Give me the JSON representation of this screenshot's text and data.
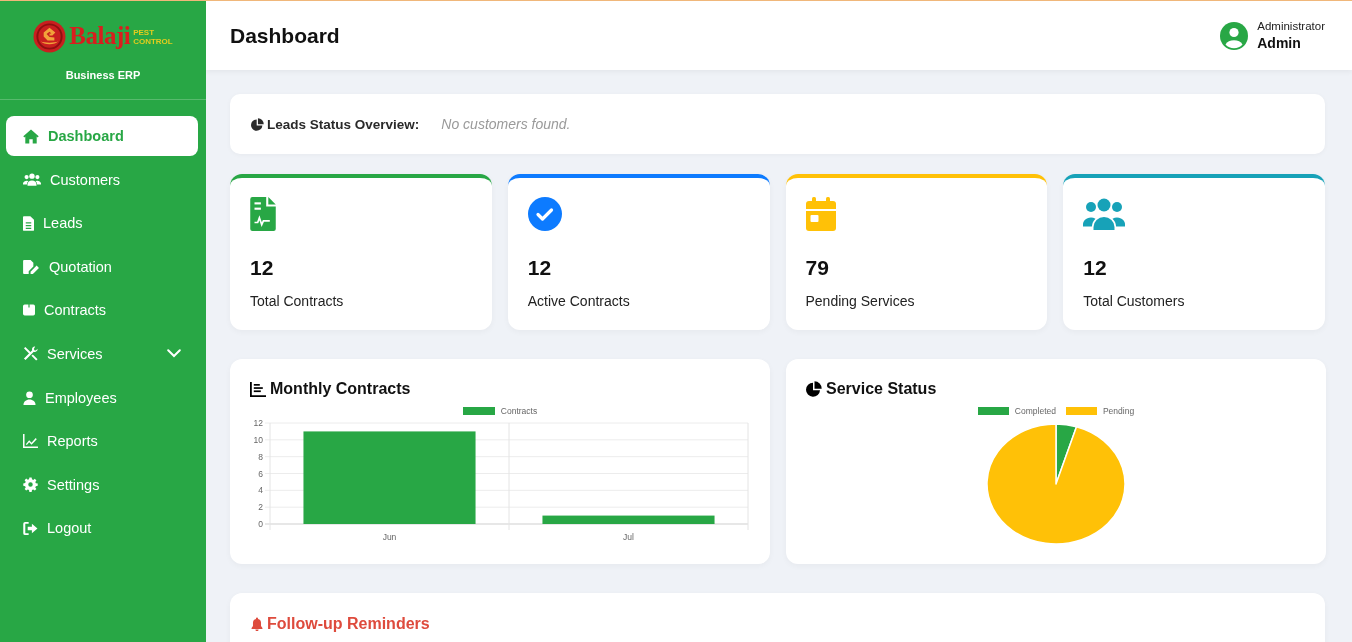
{
  "sidebar": {
    "logo": {
      "name": "Balaji",
      "tagline": "PEST CONTROL"
    },
    "subtitle": "Business ERP",
    "items": [
      {
        "label": "Dashboard",
        "kind": "link",
        "selected": true
      },
      {
        "label": "Customers",
        "kind": "link",
        "selected": false
      },
      {
        "label": "Leads",
        "kind": "link",
        "selected": false
      },
      {
        "label": "Quotation",
        "kind": "link",
        "selected": false
      },
      {
        "label": "Contracts",
        "kind": "link",
        "selected": false
      },
      {
        "label": "Services",
        "kind": "group",
        "selected": false
      },
      {
        "label": "Employees",
        "kind": "link",
        "selected": false
      },
      {
        "label": "Reports",
        "kind": "link",
        "selected": false
      },
      {
        "label": "Settings",
        "kind": "link",
        "selected": false
      },
      {
        "label": "Logout",
        "kind": "link",
        "selected": false
      }
    ]
  },
  "header": {
    "title": "Dashboard",
    "user": {
      "role": "Administrator",
      "name": "Admin"
    }
  },
  "leads_overview": {
    "label": "Leads Status Overview:",
    "message": "No customers found."
  },
  "stats": [
    {
      "value": "12",
      "label": "Total Contracts",
      "color": "#28a745"
    },
    {
      "value": "12",
      "label": "Active Contracts",
      "color": "#0d7bff"
    },
    {
      "value": "79",
      "label": "Pending Services",
      "color": "#ffc107"
    },
    {
      "value": "12",
      "label": "Total Customers",
      "color": "#17a2b8"
    }
  ],
  "charts": [
    {
      "kind": "chart",
      "title": "Monthly Contracts",
      "chart_data": {
        "type": "bar",
        "categories": [
          "Jun",
          "Jul"
        ],
        "series": [
          {
            "name": "Contracts",
            "color": "#28a745",
            "values": [
              11,
              1
            ]
          }
        ],
        "ylim": [
          0,
          12
        ],
        "yticks": [
          0,
          2,
          4,
          6,
          8,
          10,
          12
        ],
        "grid": true
      }
    },
    {
      "kind": "pie",
      "title": "Service Status",
      "legend": [
        {
          "label": "Completed",
          "color": "#28a745"
        },
        {
          "label": "Pending",
          "color": "#ffc107"
        }
      ]
    }
  ],
  "follow_up_reminders": {
    "title": "Follow-up Reminders"
  }
}
